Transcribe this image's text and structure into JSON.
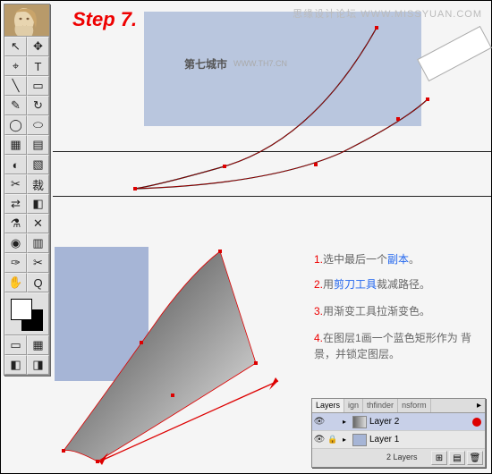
{
  "step_label": "Step 7.",
  "watermarks": {
    "top_right": "思缘设计论坛  WWW.MISSYUAN.COM",
    "center": "第七城市",
    "center_url": "WWW.TH7.CN"
  },
  "instructions": [
    {
      "num": "1.",
      "pre": "选中最后一个",
      "hi": "副本",
      "post": "。"
    },
    {
      "num": "2.",
      "pre": "用",
      "hi": "剪刀工具",
      "post": "裁减路径。"
    },
    {
      "num": "3.",
      "pre": "用渐变工具拉渐变色。",
      "hi": "",
      "post": ""
    },
    {
      "num": "4.",
      "pre": "在图层1画一个蓝色矩形作为  背景，并锁定图层。",
      "hi": "",
      "post": ""
    }
  ],
  "layers_panel": {
    "tabs": [
      "Layers",
      "ign",
      "thfinder",
      "nsform"
    ],
    "rows": [
      {
        "name": "Layer 2",
        "swatch": "linear-gradient(90deg,#666,#ddd)",
        "selected": true,
        "dot": true
      },
      {
        "name": "Layer 1",
        "swatch": "#a6b5d6",
        "selected": false,
        "dot": false
      }
    ],
    "count": "2 Layers"
  },
  "toolbox_icons": [
    [
      "↖",
      "✥"
    ],
    [
      "⌖",
      "T"
    ],
    [
      "╲",
      "▭"
    ],
    [
      "✎",
      "↻"
    ],
    [
      "◯",
      "⬭"
    ],
    [
      "▦",
      "▤"
    ],
    [
      "◐",
      "▧"
    ],
    [
      "✂",
      "裁"
    ],
    [
      "⇄",
      "◧"
    ],
    [
      "⚗",
      "✕"
    ],
    [
      "◉",
      "▥"
    ],
    [
      "✑",
      "✂"
    ],
    [
      "✋",
      "Q"
    ]
  ],
  "colors": {
    "fill": "#ffffff",
    "stroke": "#000000"
  }
}
